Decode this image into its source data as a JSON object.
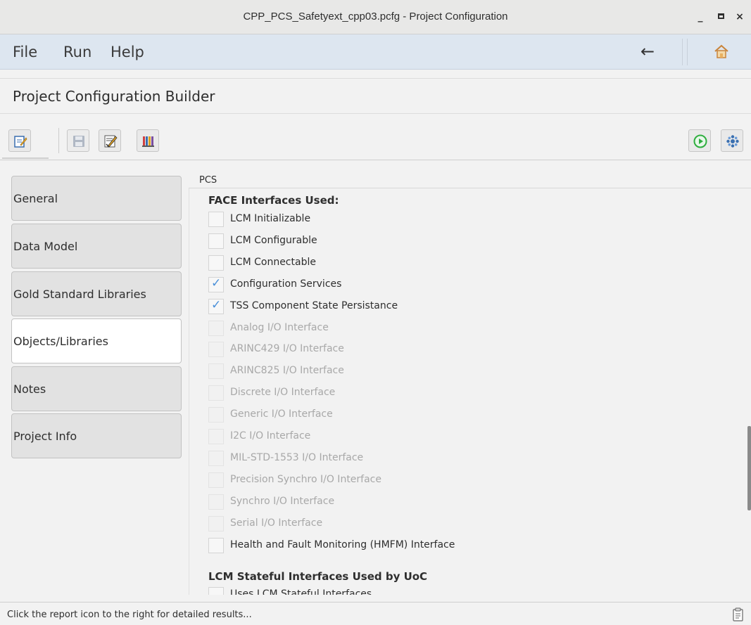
{
  "window": {
    "title": "CPP_PCS_Safetyext_cpp03.pcfg - Project Configuration",
    "minimize_label": "_",
    "close_label": "×"
  },
  "menu": {
    "file": "File",
    "run": "Run",
    "help": "Help",
    "back_glyph": "←"
  },
  "heading": "Project Configuration Builder",
  "toolbar": {
    "buttons": [
      "edit-icon",
      "save-icon",
      "edit-list-icon",
      "books-icon",
      "run-icon",
      "settings-icon"
    ]
  },
  "sidebar": {
    "items": [
      {
        "label": "General"
      },
      {
        "label": "Data Model"
      },
      {
        "label": "Gold Standard Libraries"
      },
      {
        "label": "Objects/Libraries"
      },
      {
        "label": "Notes"
      },
      {
        "label": "Project Info"
      }
    ],
    "active": "Objects/Libraries"
  },
  "content": {
    "panel_title": "PCS",
    "group1_title": "FACE Interfaces Used:",
    "interfaces": [
      {
        "label": "LCM Initializable",
        "checked": false,
        "enabled": true
      },
      {
        "label": "LCM Configurable",
        "checked": false,
        "enabled": true
      },
      {
        "label": "LCM Connectable",
        "checked": false,
        "enabled": true
      },
      {
        "label": "Configuration Services",
        "checked": true,
        "enabled": true
      },
      {
        "label": "TSS Component State Persistance",
        "checked": true,
        "enabled": true
      },
      {
        "label": "Analog I/O Interface",
        "checked": false,
        "enabled": false
      },
      {
        "label": "ARINC429 I/O Interface",
        "checked": false,
        "enabled": false
      },
      {
        "label": "ARINC825 I/O Interface",
        "checked": false,
        "enabled": false
      },
      {
        "label": "Discrete I/O Interface",
        "checked": false,
        "enabled": false
      },
      {
        "label": "Generic I/O Interface",
        "checked": false,
        "enabled": false
      },
      {
        "label": "I2C I/O Interface",
        "checked": false,
        "enabled": false
      },
      {
        "label": "MIL-STD-1553 I/O Interface",
        "checked": false,
        "enabled": false
      },
      {
        "label": "Precision Synchro I/O Interface",
        "checked": false,
        "enabled": false
      },
      {
        "label": "Synchro I/O Interface",
        "checked": false,
        "enabled": false
      },
      {
        "label": "Serial I/O Interface",
        "checked": false,
        "enabled": false
      },
      {
        "label": "Health and Fault Monitoring (HMFM) Interface",
        "checked": false,
        "enabled": true
      }
    ],
    "group2_title": "LCM Stateful Interfaces Used by UoC",
    "group2_first_item": "Uses LCM Stateful Interfaces",
    "check_glyph": "✓"
  },
  "status": {
    "message": "Click the report icon to the right for detailed results..."
  },
  "colors": {
    "menubar_bg": "#dde6f0",
    "check_color": "#4a90d9",
    "run_green": "#2eae3e",
    "settings_blue": "#3a6fb0"
  }
}
